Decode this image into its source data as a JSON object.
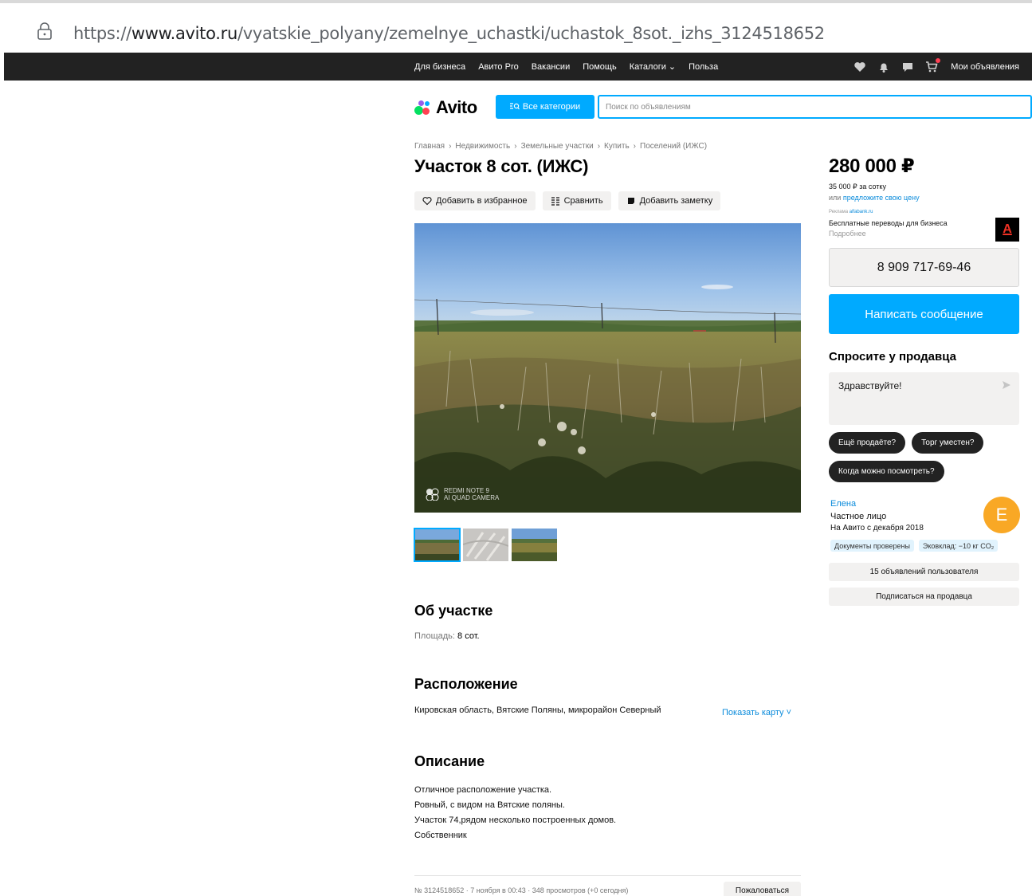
{
  "browser": {
    "url_prefix": "https://",
    "url_domain": "www.avito.ru",
    "url_path": "/vyatskie_polyany/zemelnye_uchastki/uchastok_8sot._izhs_3124518652"
  },
  "topnav": {
    "links": [
      "Для бизнеса",
      "Авито Pro",
      "Вакансии",
      "Помощь",
      "Каталоги ⌄",
      "Польза"
    ],
    "my_ads": "Мои объявления"
  },
  "header": {
    "logo": "Avito",
    "categories_button": "Все категории",
    "search_placeholder": "Поиск по объявлениям"
  },
  "breadcrumbs": [
    "Главная",
    "Недвижимость",
    "Земельные участки",
    "Купить",
    "Поселений (ИЖС)"
  ],
  "listing": {
    "title": "Участок 8 сот. (ИЖС)",
    "actions": {
      "favorite": "Добавить в избранное",
      "compare": "Сравнить",
      "note": "Добавить заметку"
    },
    "watermark_line1": "REDMI NOTE 9",
    "watermark_line2": "AI QUAD CAMERA",
    "about_heading": "Об участке",
    "area_label": "Площадь:",
    "area_value": "8 сот.",
    "location_heading": "Расположение",
    "address": "Кировская область, Вятские Поляны, микрорайон Северный",
    "show_map": "Показать карту ˅",
    "description_heading": "Описание",
    "description_lines": [
      "Отличное расположение участка.",
      "Ровный, с видом на Вятские поляны.",
      "Участок 74,рядом несколько построенных домов.",
      "Собственник"
    ],
    "meta": "№ 3124518652 · 7 ноября в 00:43 · 348 просмотров (+0 сегодня)",
    "complain": "Пожаловаться"
  },
  "sidebar": {
    "price": "280 000 ₽",
    "price_per_unit": "35 000 ₽ за сотку",
    "offer_prefix": "или",
    "offer_link": "предложите свою цену",
    "ad_label": "Реклама",
    "ad_domain": "alfabank.ru",
    "ad_title": "Бесплатные переводы для бизнеса",
    "ad_more": "Подробнее",
    "ad_logo": "А",
    "phone": "8 909 717-69-46",
    "message_button": "Написать сообщение",
    "ask_heading": "Спросите у продавца",
    "ask_text": "Здравствуйте!",
    "quick_questions": [
      "Ещё продаёте?",
      "Торг уместен?",
      "Когда можно посмотреть?"
    ],
    "seller": {
      "name": "Елена",
      "type": "Частное лицо",
      "since": "На Авито с декабря 2018",
      "avatar_letter": "Е",
      "badges": [
        "Документы проверены",
        "Эковклад: −10 кг CO₂"
      ]
    },
    "user_ads": "15 объявлений пользователя",
    "subscribe": "Подписаться на продавца"
  },
  "colors": {
    "accent": "#00aaff",
    "nav_bg": "#222222",
    "link": "#0a8bdb",
    "avatar": "#f9a825",
    "button_grey": "#f2f1f0"
  }
}
